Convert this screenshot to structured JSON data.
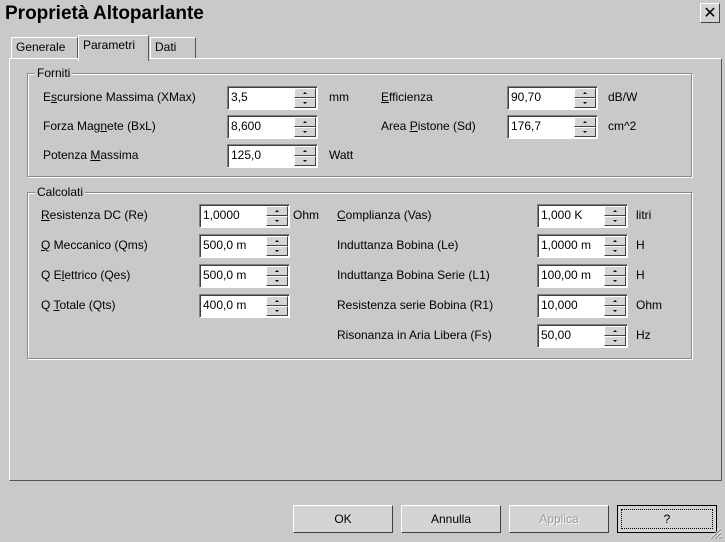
{
  "window": {
    "title": "Proprietà Altoparlante",
    "close_glyph": "✕"
  },
  "tabs": [
    {
      "label": "Generale",
      "active": false
    },
    {
      "label": "Parametri",
      "active": true
    },
    {
      "label": "Dati",
      "active": false
    }
  ],
  "forniti": {
    "title": "Forniti",
    "fields": [
      {
        "pre": "E",
        "ul": "s",
        "post": "cursione Massima (XMax)",
        "value": "3,5",
        "unit": "mm"
      },
      {
        "pre": "Forza Mag",
        "ul": "n",
        "post": "ete (BxL)",
        "value": "8,600",
        "unit": ""
      },
      {
        "pre": "Potenza ",
        "ul": "M",
        "post": "assima",
        "value": "125,0",
        "unit": "Watt"
      },
      {
        "pre": "",
        "ul": "E",
        "post": "fficienza",
        "value": "90,70",
        "unit": "dB/W"
      },
      {
        "pre": "Area ",
        "ul": "P",
        "post": "istone (Sd)",
        "value": "176,7",
        "unit": "cm^2"
      }
    ]
  },
  "calcolati": {
    "title": "Calcolati",
    "fields": [
      {
        "pre": "",
        "ul": "R",
        "post": "esistenza DC (Re)",
        "value": "1,0000",
        "unit": "Ohm"
      },
      {
        "pre": "",
        "ul": "Q",
        "post": " Meccanico (Qms)",
        "value": "500,0 m",
        "unit": ""
      },
      {
        "pre": "Q E",
        "ul": "l",
        "post": "ettrico (Qes)",
        "value": "500,0 m",
        "unit": ""
      },
      {
        "pre": "Q ",
        "ul": "T",
        "post": "otale (Qts)",
        "value": "400,0 m",
        "unit": ""
      },
      {
        "pre": "",
        "ul": "C",
        "post": "omplianza (Vas)",
        "value": "1,000 K",
        "unit": "litri"
      },
      {
        "pre": "Induttanza Bobina (Le)",
        "ul": "",
        "post": "",
        "value": "1,0000 m",
        "unit": "H"
      },
      {
        "pre": "Induttan",
        "ul": "z",
        "post": "a Bobina Serie (L1)",
        "value": "100,00 m",
        "unit": "H"
      },
      {
        "pre": "Resistenza serie Bobina (R1)",
        "ul": "",
        "post": "",
        "value": "10,000",
        "unit": "Ohm"
      },
      {
        "pre": "Risonanza in Aria Libera (Fs)",
        "ul": "",
        "post": "",
        "value": "50,00",
        "unit": "Hz"
      }
    ]
  },
  "buttons": {
    "ok": "OK",
    "cancel": "Annulla",
    "apply": "Applica",
    "help": "?"
  },
  "colors": {
    "background": "#c9c9c9",
    "field": "#ffffff",
    "disabled_text": "#9a9a9a"
  }
}
